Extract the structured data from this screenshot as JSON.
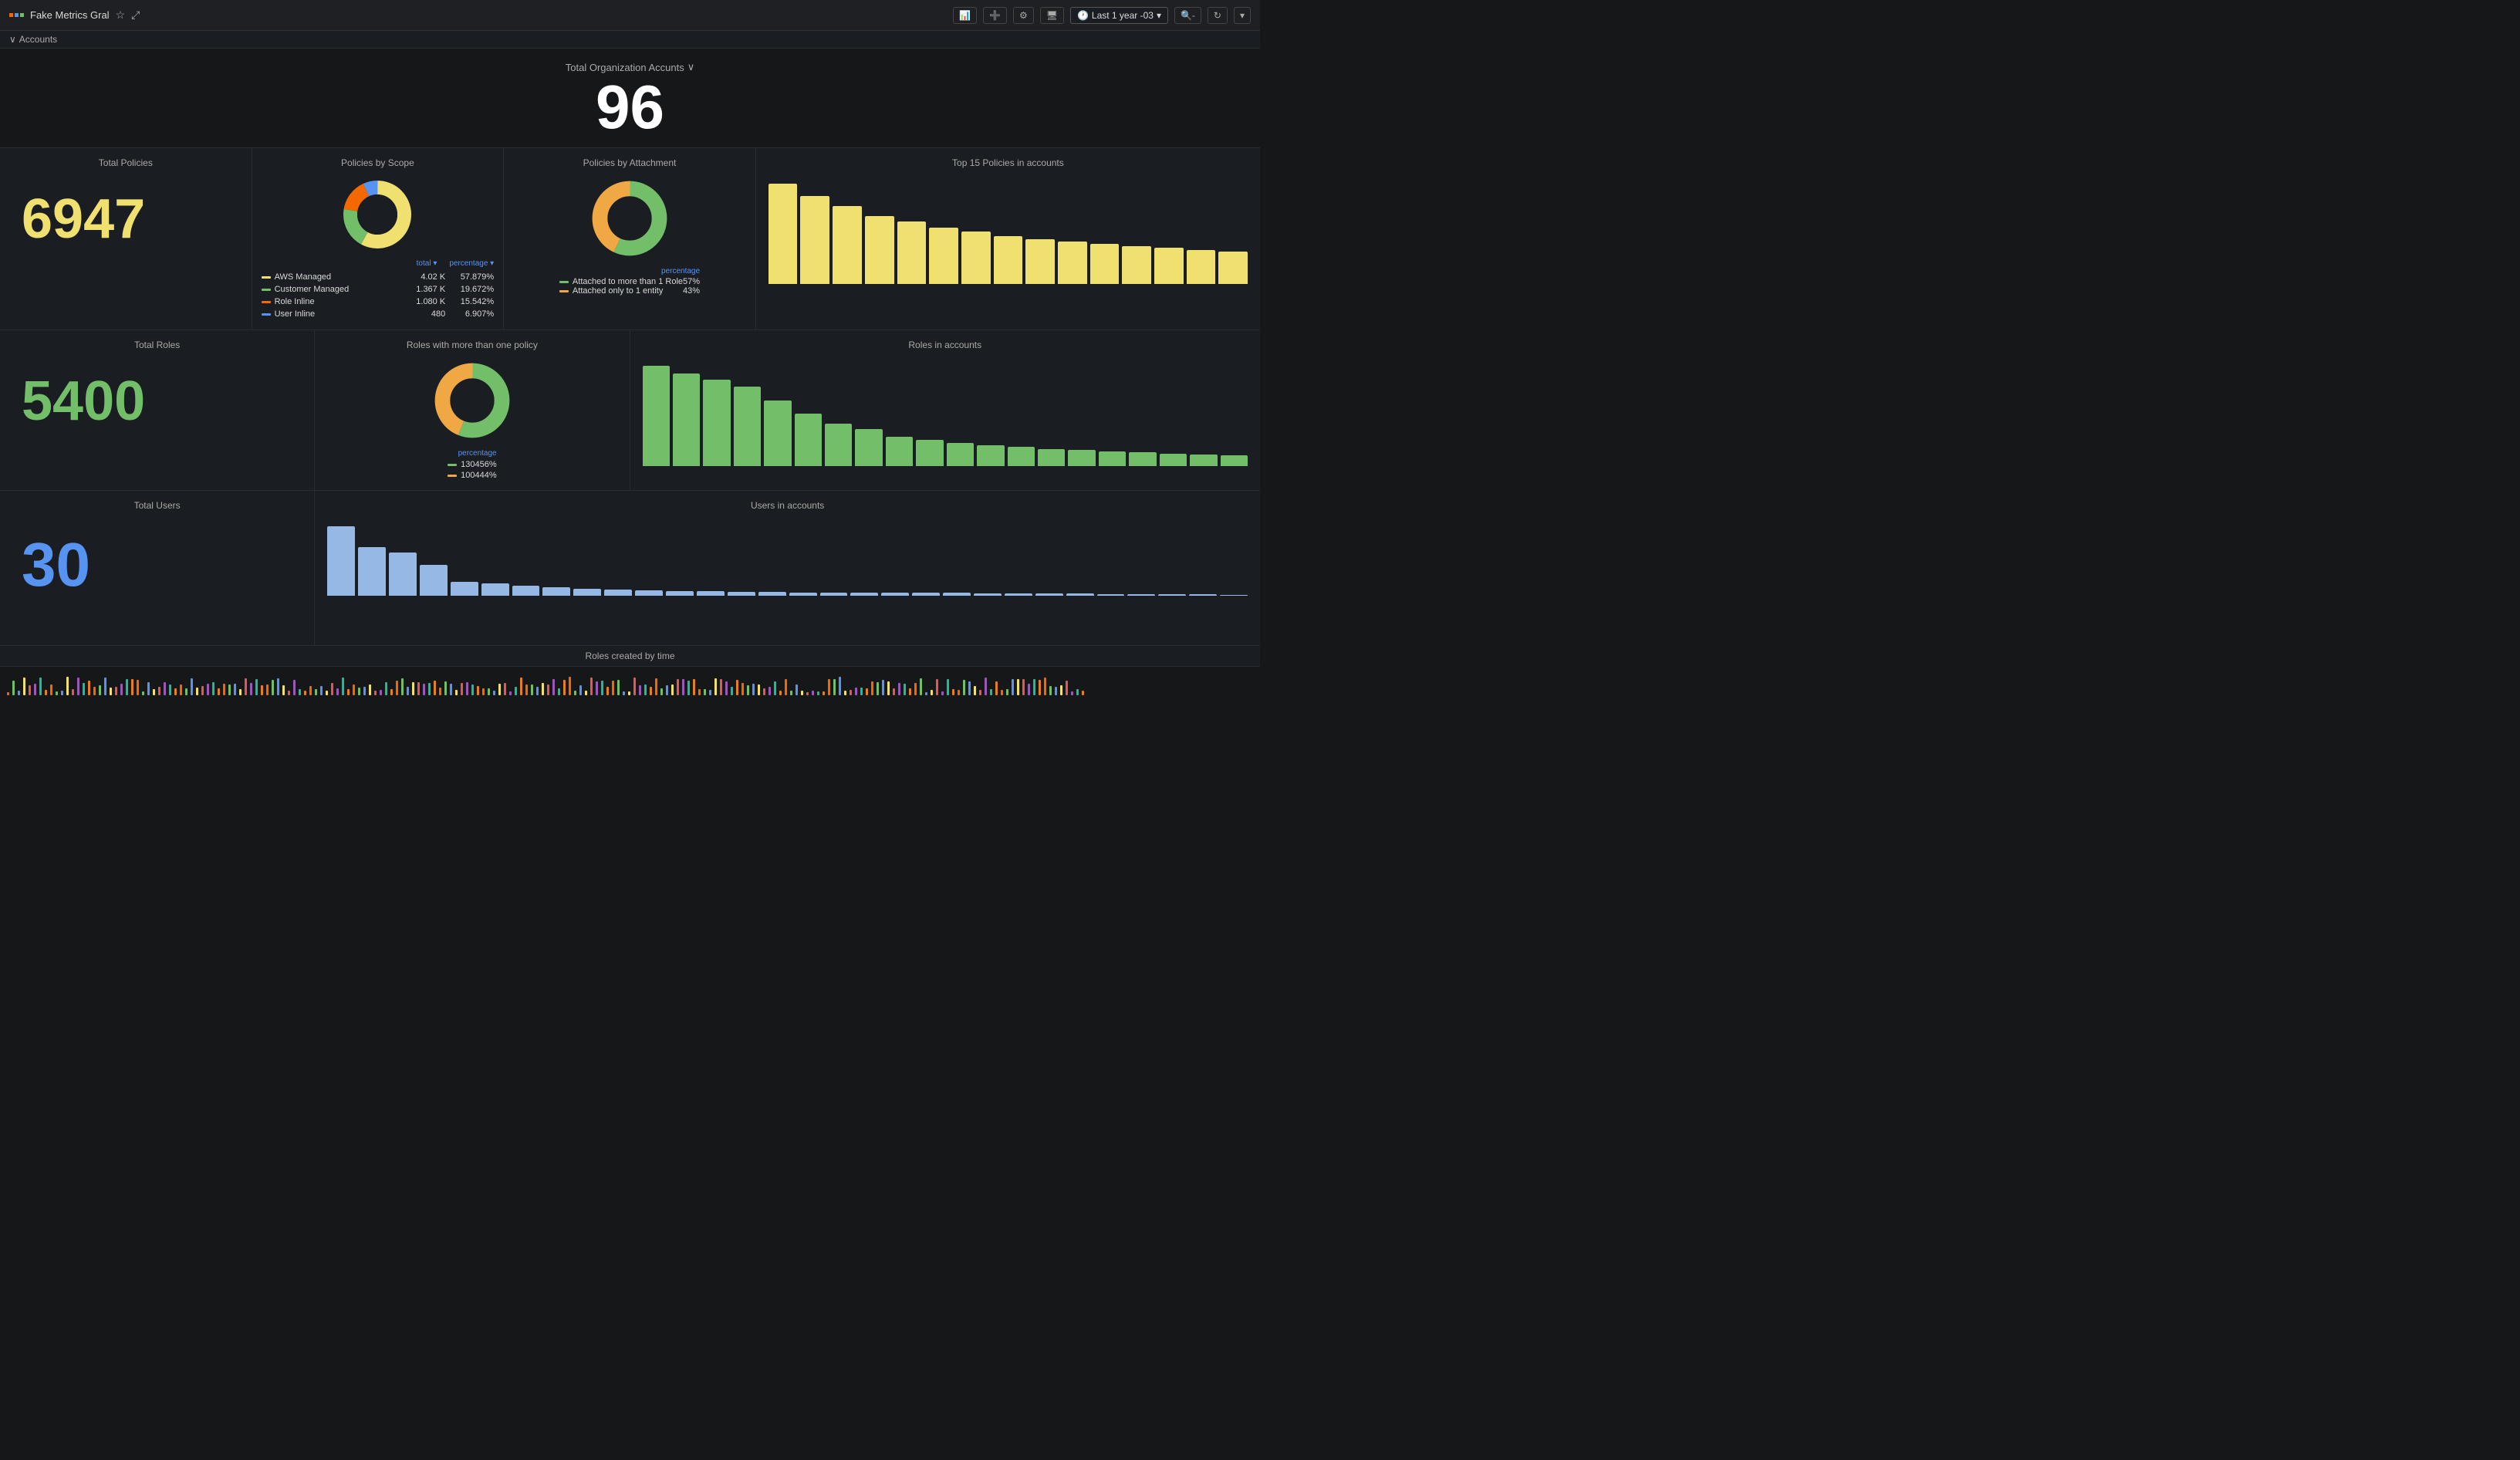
{
  "topbar": {
    "app_title": "Fake Metrics Gral",
    "time_label": "Last 1 year -03",
    "icons": {
      "bar_chart": "📊",
      "add": "➕",
      "settings": "⚙",
      "tv": "🖥",
      "clock": "🕐",
      "refresh": "↻",
      "chevron": "▾",
      "expand": "⤢"
    }
  },
  "breadcrumb": {
    "label": "Accounts",
    "chevron": "∨"
  },
  "total_org": {
    "label": "Total Organization Accunts",
    "chevron": "∨",
    "value": "96"
  },
  "panels": {
    "total_policies": {
      "title": "Total Policies",
      "value": "6947"
    },
    "policies_by_scope": {
      "title": "Policies by Scope",
      "legend_header": [
        "total ▾",
        "percentage ▾"
      ],
      "items": [
        {
          "label": "AWS Managed",
          "color": "#f0e070",
          "total": "4.02 K",
          "pct": "57.879%"
        },
        {
          "label": "Customer Managed",
          "color": "#73bf69",
          "total": "1.367 K",
          "pct": "19.672%"
        },
        {
          "label": "Role Inline",
          "color": "#f46800",
          "total": "1.080 K",
          "pct": "15.542%"
        },
        {
          "label": "User Inline",
          "color": "#5794f2",
          "total": "480",
          "pct": "6.907%"
        }
      ],
      "donut": {
        "segments": [
          {
            "color": "#f0e070",
            "pct": 57.879
          },
          {
            "color": "#73bf69",
            "pct": 19.672
          },
          {
            "color": "#f46800",
            "pct": 15.542
          },
          {
            "color": "#5794f2",
            "pct": 6.907
          }
        ]
      }
    },
    "policies_by_attachment": {
      "title": "Policies by Attachment",
      "legend_header": "percentage",
      "items": [
        {
          "label": "Attached to more than 1 Role",
          "color": "#73bf69",
          "pct": "57%"
        },
        {
          "label": "Attached only to 1 entity",
          "color": "#f0a844",
          "pct": "43%"
        }
      ],
      "donut": {
        "segments": [
          {
            "color": "#73bf69",
            "pct": 57
          },
          {
            "color": "#f0a844",
            "pct": 43
          }
        ]
      }
    },
    "top15_policies": {
      "title": "Top 15 Policies in accounts",
      "bars": [
        100,
        88,
        78,
        68,
        62,
        56,
        52,
        48,
        45,
        42,
        40,
        38,
        36,
        34,
        32
      ]
    },
    "total_roles": {
      "title": "Total Roles",
      "value": "5400"
    },
    "roles_with_more_than_one": {
      "title": "Roles with more than one policy",
      "legend_header": "percentage",
      "items": [
        {
          "label": "1304",
          "color": "#73bf69",
          "pct": "56%"
        },
        {
          "label": "1004",
          "color": "#f0a844",
          "pct": "44%"
        }
      ],
      "donut": {
        "segments": [
          {
            "color": "#73bf69",
            "pct": 56
          },
          {
            "color": "#f0a844",
            "pct": 44
          }
        ]
      }
    },
    "roles_in_accounts": {
      "title": "Roles in accounts",
      "bars": [
        95,
        88,
        82,
        75,
        62,
        50,
        40,
        35,
        28,
        25,
        22,
        20,
        18,
        16,
        15,
        14,
        13,
        12,
        11,
        10
      ]
    },
    "total_users": {
      "title": "Total Users",
      "value": "30"
    },
    "users_in_accounts": {
      "title": "Users in accounts",
      "bars": [
        100,
        70,
        62,
        45,
        20,
        18,
        15,
        12,
        10,
        9,
        8,
        7,
        7,
        6,
        6,
        5,
        5,
        5,
        4,
        4,
        4,
        3,
        3,
        3,
        3,
        2,
        2,
        2,
        2,
        1
      ]
    }
  },
  "bottom_bar": {
    "label": "Roles created by time"
  }
}
